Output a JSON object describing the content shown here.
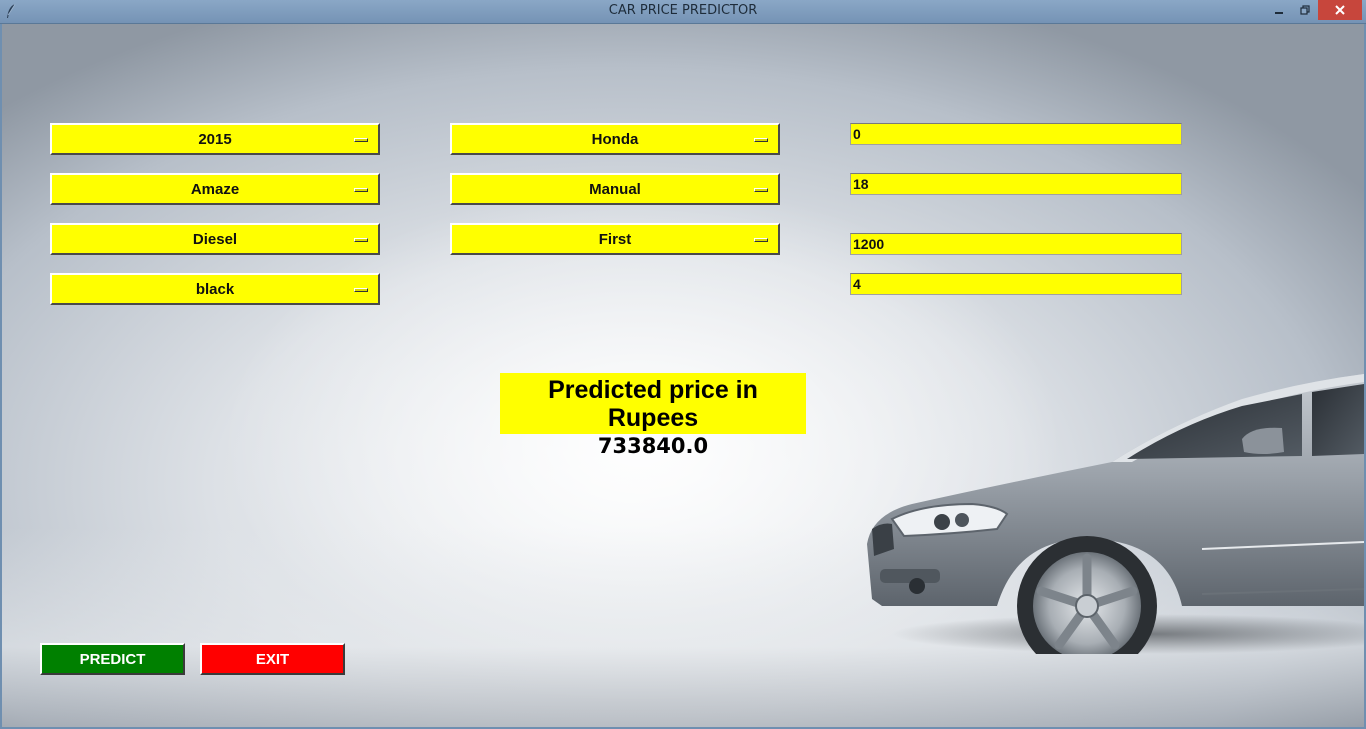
{
  "window": {
    "title": "CAR PRICE PREDICTOR"
  },
  "form": {
    "year": "2015",
    "brand": "Honda",
    "model": "Amaze",
    "transmission": "Manual",
    "fuel_type": "Diesel",
    "owner": "First",
    "color": "black"
  },
  "entries": {
    "field1": "0",
    "field2": "18",
    "field3": "1200",
    "field4": "4"
  },
  "result": {
    "title": "Predicted price in Rupees",
    "value": "733840.0"
  },
  "buttons": {
    "predict": "PREDICT",
    "exit": "EXIT"
  },
  "colors": {
    "field_bg": "#ffff00",
    "predict_bg": "#008000",
    "exit_bg": "#ff0000",
    "close_bg": "#c7463c"
  }
}
